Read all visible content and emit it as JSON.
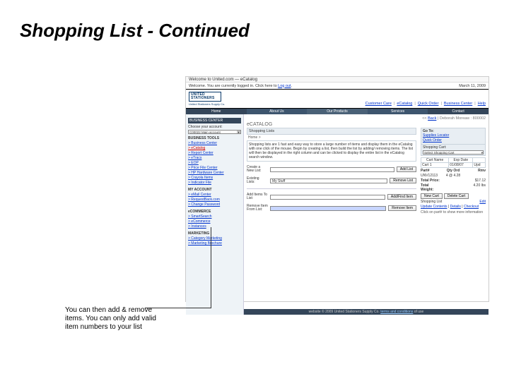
{
  "title": "Shopping List - Continued",
  "caption": "You can then add & remove items.  You can only add valid item numbers to your list",
  "shot": {
    "url_hint": "Welcome to United.com — eCatalog",
    "welcome": "Welcome. You are currently logged in. Click here to ",
    "logout": "Log out",
    "date": "March 11, 2009",
    "logo_line1": "UNITED",
    "logo_line2": "STATIONERS",
    "logo_sub": "United Stationers Supply Co.",
    "links": [
      "Customer Care",
      "eCatalog",
      "Quick Order",
      "Business Center",
      "Help"
    ],
    "nav": [
      "Home",
      "About Us",
      "Our Products",
      "Services",
      "Contact"
    ],
    "sidebar": {
      "hdr0": "BUSINESS CENTER",
      "choose_label": "Choose your account:",
      "account": "C00022 Main account",
      "g1": "BUSINESS TOOLS",
      "i1": [
        "> Business Center",
        "> eCatalog",
        "> Report Center",
        "> eTracs",
        "> EOP",
        "> Price File Center",
        "> HP Hardware Center",
        "> Crayola Items",
        "> Indicator File"
      ],
      "g2": "MY ACCOUNT",
      "i2": [
        "> eMail Center",
        "> RequestBack.com",
        "> Change Password"
      ],
      "g3": "eCOMMERCE",
      "i3": [
        "> SmartSearch",
        "> eCommerce",
        "> Instances"
      ],
      "g4": "MARKETING",
      "i4": [
        "> Category Marketing",
        "> Marketing Brochure"
      ]
    },
    "main": {
      "back": "Back",
      "user": "Deborah Moreaw : 800002",
      "ecat": "eCATALOG",
      "panel_title": "Shopping Lists",
      "panel_sub": "Home >",
      "blurb": "Shopping lists are 1 fast and easy way to store a large number of items and display them in the eCatalog with one click of the mouse. Begin by creating a list, then build the list by adding/ removing items. The list will then be displayed in the right column and can be clicked to display the entire list in the eCatalog search window.",
      "create_label": "Create a New List:",
      "btn_add_list": "Add List",
      "existing_label": "Existing Lists:",
      "existing_value": "My Stuff",
      "btn_remove_list": "Remove List",
      "add_items_label": "Add Items To List:",
      "btn_add_find": "Add/Find Item",
      "remove_item_label": "Remove Item From List:",
      "btn_remove_item": "Remove Item"
    },
    "right": {
      "goto_title": "Go To:",
      "goto": [
        "Supplies Locator",
        "Quick Order"
      ],
      "cart_title": "Shopping Cart:",
      "cart_sel": "Select Shopping Cart",
      "tbl": {
        "h": [
          "Cart Name",
          "Exp Date",
          ""
        ],
        "r1": [
          "Cart 1",
          "01/08/07",
          "Upd"
        ]
      },
      "part_lbl": "Part#",
      "qty_lbl": "Qty Ord",
      "rmv_lbl": "Rmv",
      "part_val": "UNV12113",
      "qty_val": "4 @ 4.28",
      "price_val": "",
      "total_price_lbl": "Total Price:",
      "total_price": "$17.12",
      "total_weight_lbl": "Total Weight:",
      "total_weight": "4.20 lbs",
      "btn_new": "New Cart",
      "btn_del": "Delete Cart",
      "shop_list_lbl": "Shopping List",
      "edit": "Edit",
      "upd": "Update Contents",
      "det": "Details",
      "chk": "Checkout",
      "info": "Click on part# to show more information"
    },
    "footer": {
      "pre": "website © 2009 United Stationers Supply Co. ",
      "link": "terms and conditions",
      "post": " of use"
    }
  }
}
